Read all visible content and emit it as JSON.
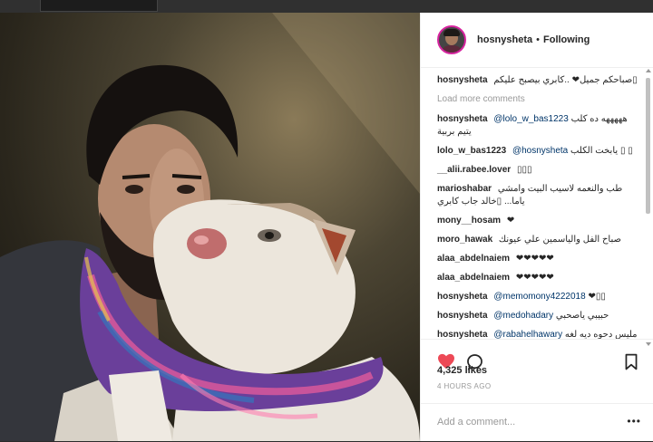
{
  "post": {
    "username": "hosnysheta",
    "separator": "•",
    "follow_status": "Following"
  },
  "comments": [
    {
      "user": "hosnysheta",
      "text": "صباحكم جميل❤ ..كابري بيصبح عليكم▯"
    },
    {
      "user": "hosnysheta",
      "mention": "@lolo_w_bas1223",
      "text": "هههههه ده كلب يتيم بربية"
    },
    {
      "user": "lolo_w_bas1223",
      "mention": "@hosnysheta",
      "text": "يابخت الكلب ▯ ▯"
    },
    {
      "user": "__alii.rabee.lover",
      "text": "▯▯▯"
    },
    {
      "user": "marioshabar",
      "text": "طب والنعمه لاسيب البيت وامشي ياما... ▯خالد جاب كابري"
    },
    {
      "user": "mony__hosam",
      "text": "❤"
    },
    {
      "user": "moro_hawak",
      "text": "صباح الفل والياسمين علي عيونك"
    },
    {
      "user": "alaa_abdelnaiem",
      "text": "❤❤❤❤❤"
    },
    {
      "user": "alaa_abdelnaiem",
      "text": "❤❤❤❤❤"
    },
    {
      "user": "hosnysheta",
      "mention": "@memomony4222018",
      "text": "❤▯▯"
    },
    {
      "user": "hosnysheta",
      "mention": "@medohadary",
      "text": "حبيبي ياصحبي"
    },
    {
      "user": "hosnysheta",
      "mention": "@rabahelhawary",
      "text": "مليس دحوه ديه لغه"
    }
  ],
  "load_more": "Load more comments",
  "likes": "4,325 likes",
  "time": "4 HOURS AGO",
  "add_comment_placeholder": "Add a comment...",
  "more_icon": "•••",
  "icons": {
    "like": "heart-icon",
    "comment": "comment-icon",
    "save": "bookmark-icon"
  },
  "colors": {
    "like_red": "#ed4956",
    "mention_blue": "#003569",
    "avatar_ring": "#d6249f"
  }
}
